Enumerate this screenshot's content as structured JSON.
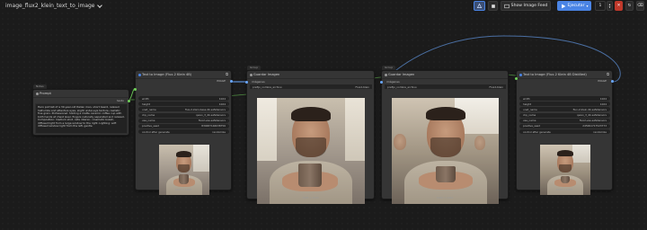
{
  "app": {
    "workflow_title": "image_flux2_klein_text_to_image"
  },
  "toolbar": {
    "show_image_feed": "Show Image Feed",
    "run_label": "Ejecutar",
    "queue_count": "1"
  },
  "prompt_node": {
    "group_label": "Notes",
    "title": "Prompt",
    "output_label": "texto",
    "text": "Hero portrait of a 30-year-old Italian man, short beard, relaxed half-smile and attentive eyes, slight under-eye texture, realistic fine grain. Professional: holding a matte ceramic coffee cup with both hands at chest level, fingers naturally separated and relaxed. Composition: medium shot, cafe interior, cinematic bokeh, diffused light from a large window to the right. Lighting: soft diffused window light from the left, gentle"
  },
  "t2i_left": {
    "title": "Text to Image (Flux.2 Klein 4B)",
    "output_label": "IMAGE",
    "widgets": [
      {
        "name": "width",
        "value": "1024"
      },
      {
        "name": "height",
        "value": "1024"
      },
      {
        "name": "unet_name",
        "value": "flux-2-klein-base-4b.safetensors"
      },
      {
        "name": "clip_name",
        "value": "qwen_3_4b.safetensors"
      },
      {
        "name": "vae_name",
        "value": "flux2-vae.safetensors"
      },
      {
        "name": "positive_seed",
        "value": "839487146038756"
      },
      {
        "name": "control after generate",
        "value": "randomize"
      }
    ],
    "caption": "1024 × 1024"
  },
  "preview_1": {
    "group_label": "Group",
    "title": "Guardar Imagen",
    "input_label": "imágenes",
    "prefix_name": "prefijo_nombre_archivo",
    "prefix_value": "Flux2-Klein",
    "caption": "1024 × 1024"
  },
  "preview_2": {
    "group_label": "Group",
    "title": "Guardar Imagen",
    "input_label": "imágenes",
    "prefix_name": "prefijo_nombre_archivo",
    "prefix_value": "Flux2-Klein",
    "caption": "1024 × 1024"
  },
  "t2i_right": {
    "title": "Text to Image (Flux.2 Klein 4B Distilled)",
    "output_label": "IMAGE",
    "widgets": [
      {
        "name": "width",
        "value": "1024"
      },
      {
        "name": "height",
        "value": "1024"
      },
      {
        "name": "unet_name",
        "value": "flux-2-klein-4b.safetensors"
      },
      {
        "name": "clip_name",
        "value": "qwen_3_4b.safetensors"
      },
      {
        "name": "vae_name",
        "value": "flux2-vae.safetensors"
      },
      {
        "name": "positive_seed",
        "value": "245991717523773"
      },
      {
        "name": "control after generate",
        "value": "randomize"
      }
    ],
    "caption": "1024 × 1024"
  },
  "colors": {
    "canvas": "#1b1b1b",
    "node_body": "#353535",
    "link_blue": "#6aa8ff",
    "link_green": "#6fcf5a",
    "run_button": "#4a84e5",
    "close_button": "#c0392b"
  }
}
